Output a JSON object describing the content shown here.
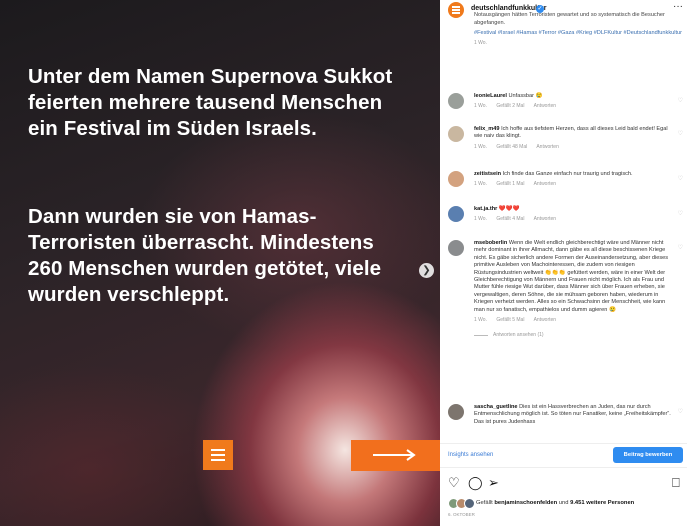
{
  "post": {
    "text_1": "Unter dem Namen Supernova Sukkot feierten mehrere tausend Menschen ein Festival im Süden Israels.",
    "text_2": "Dann wurden sie von Hamas-Terroristen überrascht. Mindestens 260 Menschen wurden getötet, viele wurden verschleppt.",
    "brand_color": "#f07a1c"
  },
  "header": {
    "account_name": "deutschlandfunkkultur",
    "verified": true
  },
  "caption": {
    "text": "Notausgängen hätten Terroristen gewartet und so systematisch die Besucher abgefangen.",
    "hashtags": "#Festival #Israel #Hamas #Terror #Gaza #Krieg #DLFKultur #Deutschlandfunkkultur",
    "age": "1 Wo."
  },
  "comments": [
    {
      "user": "leonieLaurel",
      "text": "Unfassbar 😢",
      "meta": [
        "1 Wo.",
        "Gefällt 2 Mal",
        "Antworten"
      ]
    },
    {
      "user": "felix_m49",
      "text": "Ich hoffe aus tiefstem Herzen, dass all dieses Leid bald endet! Egal wie naiv das klingt.",
      "meta": [
        "1 Wo.",
        "Gefällt 48 Mal",
        "Antworten"
      ]
    },
    {
      "user": "zeitistsein",
      "text": "Ich finde das Ganze einfach nur traurig und tragisch.",
      "meta": [
        "1 Wo.",
        "Gefällt 1 Mal",
        "Antworten"
      ]
    },
    {
      "user": "kat.ja.thr",
      "text": "❤️❤️❤️",
      "meta": [
        "1 Wo.",
        "Gefällt 4 Mal",
        "Antworten"
      ]
    },
    {
      "user": "mseboberlin",
      "text": "Wenn die Welt endlich gleichberechtigt wäre und Männer nicht mehr dominant in ihrer Allmacht, dann gäbe es all diese beschissenen Kriege nicht. Es gäbe sicherlich andere Formen der Auseinandersetzung, aber dieses primitive Ausleben von Machointeressen, die zudem von riesigen Rüstungsindustrien weltweit 👏👏👏 gefüttert werden, wäre in einer Welt der Gleichberechtigung von Männern und Frauen nicht möglich. Ich als Frau und Mutter fühle riesige Wut darüber, dass Männer sich über Frauen erheben, sie vergewaltigen, deren Söhne, die sie mühsam geboren haben, wiederum in Kriegen verheizt werden. Alles so ein Schwachsinn der Menschheit, wie kann man nur so fanatisch, empathielos und dumm agieren 😢",
      "meta": [
        "1 Wo.",
        "Gefällt 5 Mal",
        "Antworten"
      ],
      "replies": "Antworten ansehen (1)"
    },
    {
      "user": "sascha_guetline",
      "text": "Dies ist ein Hassverbrechen an Juden, das nur durch Entmenschlichung möglich ist. So töten nur Fanatiker, keine „Freiheitskämpfer“.",
      "extra": "Das ist pures Judenhass"
    }
  ],
  "footer": {
    "insights_label": "Insights ansehen",
    "boost_label": "Beitrag bewerben",
    "accent": "#2f8cf0"
  },
  "likes": {
    "prefix": "Gefällt ",
    "user": "benjaminschoenfelden",
    "middle": " und ",
    "count": "9.451 weitere Personen"
  },
  "post_date": "6. OKTOBER"
}
